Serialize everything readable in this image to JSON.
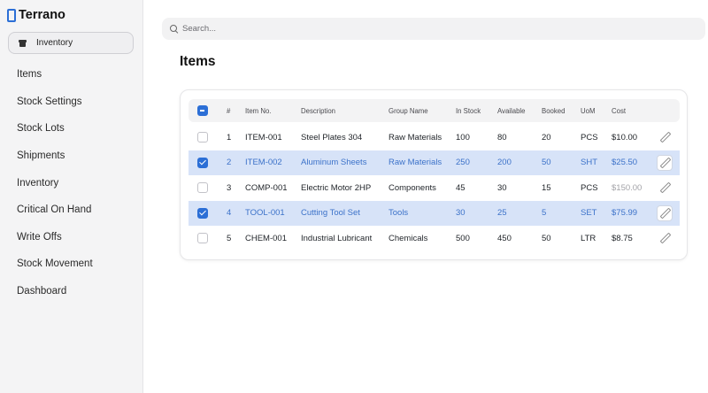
{
  "app": {
    "name": "Terrano",
    "module": "Inventory"
  },
  "sidebar": {
    "items": [
      {
        "label": "Items"
      },
      {
        "label": "Stock Settings"
      },
      {
        "label": "Stock Lots"
      },
      {
        "label": "Shipments"
      },
      {
        "label": "Inventory"
      },
      {
        "label": "Critical On Hand"
      },
      {
        "label": "Write Offs"
      },
      {
        "label": "Stock Movement"
      },
      {
        "label": "Dashboard"
      }
    ]
  },
  "search": {
    "placeholder": "Search..."
  },
  "page": {
    "title": "Items"
  },
  "table": {
    "select_all_state": "indeterminate",
    "columns": [
      "#",
      "Item No.",
      "Description",
      "Group Name",
      "In Stock",
      "Available",
      "Booked",
      "UoM",
      "Cost"
    ],
    "rows": [
      {
        "selected": false,
        "num": "1",
        "item_no": "ITEM-001",
        "description": "Steel Plates 304",
        "group": "Raw Materials",
        "in_stock": "100",
        "available": "80",
        "booked": "20",
        "uom": "PCS",
        "cost": "$10.00",
        "cost_dim": false
      },
      {
        "selected": true,
        "num": "2",
        "item_no": "ITEM-002",
        "description": "Aluminum Sheets",
        "group": "Raw Materials",
        "in_stock": "250",
        "available": "200",
        "booked": "50",
        "uom": "SHT",
        "cost": "$25.50",
        "cost_dim": false
      },
      {
        "selected": false,
        "num": "3",
        "item_no": "COMP-001",
        "description": "Electric Motor 2HP",
        "group": "Components",
        "in_stock": "45",
        "available": "30",
        "booked": "15",
        "uom": "PCS",
        "cost": "$150.00",
        "cost_dim": true
      },
      {
        "selected": true,
        "num": "4",
        "item_no": "TOOL-001",
        "description": "Cutting Tool Set",
        "group": "Tools",
        "in_stock": "30",
        "available": "25",
        "booked": "5",
        "uom": "SET",
        "cost": "$75.99",
        "cost_dim": false
      },
      {
        "selected": false,
        "num": "5",
        "item_no": "CHEM-001",
        "description": "Industrial Lubricant",
        "group": "Chemicals",
        "in_stock": "500",
        "available": "450",
        "booked": "50",
        "uom": "LTR",
        "cost": "$8.75",
        "cost_dim": false
      }
    ]
  },
  "colors": {
    "accent": "#2c6fd6",
    "selected_row": "#d7e3f8",
    "selected_text": "#3c72c9",
    "sidebar_bg": "#f4f4f5"
  }
}
